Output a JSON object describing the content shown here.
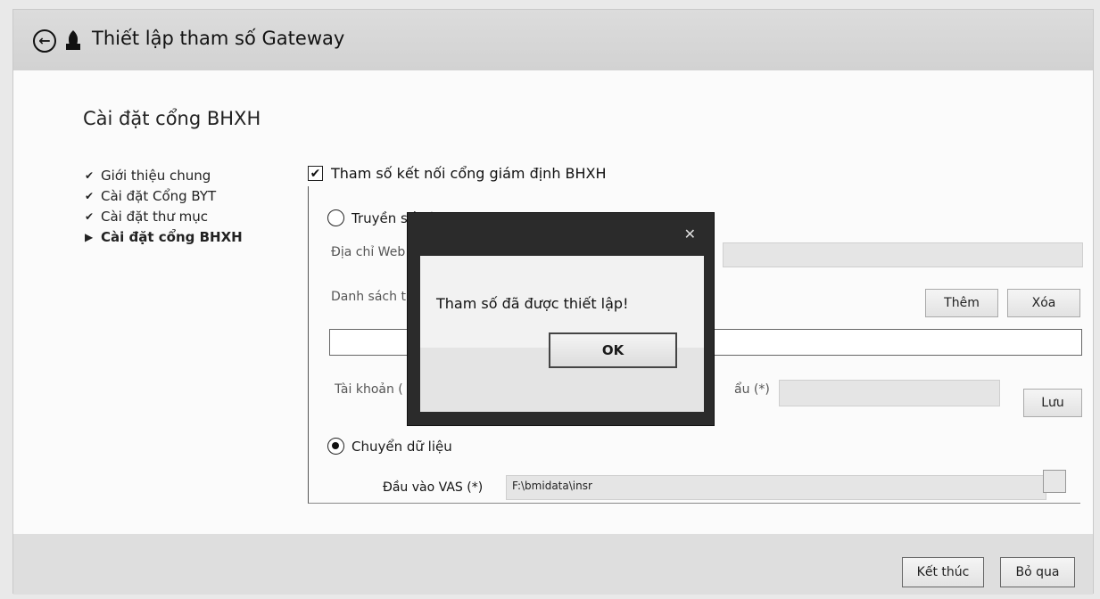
{
  "window": {
    "title": "Thiết lập tham số Gateway",
    "icons": {
      "back": "back-arrow-icon",
      "app": "app-icon"
    }
  },
  "page": {
    "heading": "Cài đặt cổng BHXH"
  },
  "steps": [
    {
      "label": "Giới thiệu chung",
      "state": "done",
      "icon": "checkmark-icon"
    },
    {
      "label": "Cài đặt Cổng BYT",
      "state": "done",
      "icon": "checkmark-icon"
    },
    {
      "label": "Cài đặt thư mục",
      "state": "done",
      "icon": "checkmark-icon"
    },
    {
      "label": "Cài đặt cổng BHXH",
      "state": "current",
      "icon": "triangle-right-icon"
    }
  ],
  "group": {
    "checkbox_label": "Tham số kết nối cổng giám định BHXH",
    "checked": true
  },
  "webservice": {
    "radio_label": "Truyền số liệu BHXH qua Web Service",
    "selected": false,
    "address_label": "Địa chỉ Web",
    "list_label": "Danh sách t",
    "add_button": "Thêm",
    "delete_button": "Xóa",
    "account_label": "Tài khoản (",
    "password_label": "ẩu (*)",
    "save_button": "Lưu"
  },
  "local": {
    "radio_label": "Chuyển dữ liệu",
    "selected": true,
    "vas_label": "Đầu vào VAS (*)",
    "vas_value": "F:\\bmidata\\insr"
  },
  "dialog": {
    "message": "Tham số đã được thiết lập!",
    "ok_button": "OK",
    "close_icon": "close-icon"
  },
  "footer": {
    "finish_button": "Kết thúc",
    "skip_button": "Bỏ qua"
  }
}
